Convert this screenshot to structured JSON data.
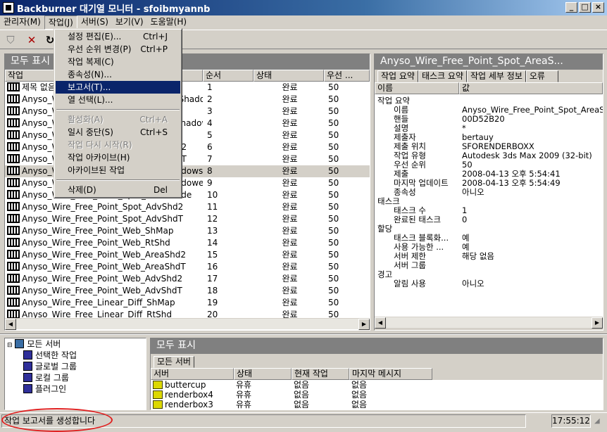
{
  "window": {
    "title": "Backburner 대기열 모니터 - sfoibmyannb",
    "min": "_",
    "max": "□",
    "close": "×"
  },
  "menubar": [
    "관리자(M)",
    "작업(J)",
    "서버(S)",
    "보기(V)",
    "도움말(H)"
  ],
  "dropdown": [
    {
      "label": "설정 편집(E)...",
      "shortcut": "Ctrl+J"
    },
    {
      "label": "우선 순위 변경(P)",
      "shortcut": "Ctrl+P"
    },
    {
      "label": "작업 복제(C)",
      "shortcut": ""
    },
    {
      "label": "종속성(N)...",
      "shortcut": ""
    },
    {
      "label": "보고서(T)...",
      "shortcut": ""
    },
    {
      "label": "열 선택(L)...",
      "shortcut": ""
    },
    {
      "label": "활성화(A)",
      "shortcut": "Ctrl+A"
    },
    {
      "label": "일시 중단(S)",
      "shortcut": "Ctrl+S"
    },
    {
      "label": "작업 다시 시작(R)",
      "shortcut": ""
    },
    {
      "label": "작업 아카이브(H)",
      "shortcut": ""
    },
    {
      "label": "아카이브된 작업",
      "shortcut": ""
    },
    {
      "label": "삭제(D)",
      "shortcut": "Del"
    }
  ],
  "jobs_panel": {
    "title": "모두 표시",
    "columns": [
      "작업",
      "순서",
      "상태",
      "우선 ..."
    ],
    "rows": [
      {
        "name": "제목 없음",
        "order": "1",
        "status": "완료",
        "priority": "50"
      },
      {
        "name": "Anyso_Wire_Free_Point_Spot_ShMap_ShadowWindow",
        "order": "2",
        "status": "완료",
        "priority": "50"
      },
      {
        "name": "Anyso_Wire_Free_Point_Spot_ShMap",
        "order": "3",
        "status": "완료",
        "priority": "50"
      },
      {
        "name": "Anyso_Wire_Free_Point_Spot_RtShd_ShadowWindow",
        "order": "4",
        "status": "완료",
        "priority": "50"
      },
      {
        "name": "Anyso_Wire_Free_Point_Spot_RtShd",
        "order": "5",
        "status": "완료",
        "priority": "50"
      },
      {
        "name": "Anyso_Wire_Free_Point_Spot_AreaShd2",
        "order": "6",
        "status": "완료",
        "priority": "50"
      },
      {
        "name": "Anyso_Wire_Free_Point_Spot_AreaShdT",
        "order": "7",
        "status": "완료",
        "priority": "50"
      },
      {
        "name": "Anyso_Wire_Free_Point_Spot_AreaShadows",
        "order": "8",
        "status": "완료",
        "priority": "50"
      },
      {
        "name": "Anyso_Wire_Free_Point_Spot_AreaShadowe",
        "order": "9",
        "status": "완료",
        "priority": "50"
      },
      {
        "name": "Anyso_Wire_Free_Point_Spot_AreaShade",
        "order": "10",
        "status": "완료",
        "priority": "50"
      },
      {
        "name": "Anyso_Wire_Free_Point_Spot_AdvShd2",
        "order": "11",
        "status": "완료",
        "priority": "50"
      },
      {
        "name": "Anyso_Wire_Free_Point_Spot_AdvShdT",
        "order": "12",
        "status": "완료",
        "priority": "50"
      },
      {
        "name": "Anyso_Wire_Free_Point_Web_ShMap",
        "order": "13",
        "status": "완료",
        "priority": "50"
      },
      {
        "name": "Anyso_Wire_Free_Point_Web_RtShd",
        "order": "14",
        "status": "완료",
        "priority": "50"
      },
      {
        "name": "Anyso_Wire_Free_Point_Web_AreaShd2",
        "order": "15",
        "status": "완료",
        "priority": "50"
      },
      {
        "name": "Anyso_Wire_Free_Point_Web_AreaShdT",
        "order": "16",
        "status": "완료",
        "priority": "50"
      },
      {
        "name": "Anyso_Wire_Free_Point_Web_AdvShd2",
        "order": "17",
        "status": "완료",
        "priority": "50"
      },
      {
        "name": "Anyso_Wire_Free_Point_Web_AdvShdT",
        "order": "18",
        "status": "완료",
        "priority": "50"
      },
      {
        "name": "Anyso_Wire_Free_Linear_Diff_ShMap",
        "order": "19",
        "status": "완료",
        "priority": "50"
      },
      {
        "name": "Anyso_Wire_Free_Linear_Diff_RtShd",
        "order": "20",
        "status": "완료",
        "priority": "50"
      }
    ]
  },
  "details_panel": {
    "title": "Anyso_Wire_Free_Point_Spot_AreaS...",
    "tabs": [
      "작업 요약",
      "태스크 요약",
      "작업 세부 정보",
      "오류"
    ],
    "columns": [
      "이름",
      "값"
    ],
    "rows": [
      {
        "k": "작업 요약",
        "v": "",
        "indent": 0
      },
      {
        "k": "이름",
        "v": "Anyso_Wire_Free_Point_Spot_AreaS",
        "indent": 1
      },
      {
        "k": "핸들",
        "v": "00D52B20",
        "indent": 1
      },
      {
        "k": "설명",
        "v": "*",
        "indent": 1
      },
      {
        "k": "제출자",
        "v": "bertauy",
        "indent": 1
      },
      {
        "k": "제출 위치",
        "v": "SFORENDERBOXX",
        "indent": 1
      },
      {
        "k": "작업 유형",
        "v": "Autodesk 3ds Max 2009 (32-bit)",
        "indent": 1
      },
      {
        "k": "우선 순위",
        "v": "50",
        "indent": 1
      },
      {
        "k": "제출",
        "v": "2008-04-13 오후 5:54:41",
        "indent": 1
      },
      {
        "k": "마지막 업데이트",
        "v": "2008-04-13 오후 5:54:49",
        "indent": 1
      },
      {
        "k": "종속성",
        "v": "아니오",
        "indent": 1
      },
      {
        "k": "태스크",
        "v": "",
        "indent": 0
      },
      {
        "k": "태스크 수",
        "v": "1",
        "indent": 1
      },
      {
        "k": "완료된 태스크",
        "v": "0",
        "indent": 1
      },
      {
        "k": "할당",
        "v": "",
        "indent": 0
      },
      {
        "k": "태스크 블록화...",
        "v": "예",
        "indent": 1
      },
      {
        "k": "사용 가능한 ...",
        "v": "예",
        "indent": 1
      },
      {
        "k": "서버 제한",
        "v": "해당 없음",
        "indent": 1
      },
      {
        "k": "서버 그룹",
        "v": "",
        "indent": 1
      },
      {
        "k": "경고",
        "v": "",
        "indent": 0
      },
      {
        "k": "알림 사용",
        "v": "아니오",
        "indent": 1
      }
    ]
  },
  "tree": {
    "root": "모든 서버",
    "children": [
      "선택한 작업",
      "글로벌 그룹",
      "로컬 그룹",
      "플러그인"
    ]
  },
  "servers_panel": {
    "title": "모두 표시",
    "tab": "모든 서버",
    "columns": [
      "서버",
      "상태",
      "현재 작업",
      "마지막 메시지"
    ],
    "rows": [
      {
        "server": "buttercup",
        "status": "유휴",
        "job": "없음",
        "msg": "없음"
      },
      {
        "server": "renderbox4",
        "status": "유휴",
        "job": "없음",
        "msg": "없음"
      },
      {
        "server": "renderbox3",
        "status": "유휴",
        "job": "없음",
        "msg": "없음"
      }
    ]
  },
  "statusbar": {
    "message": "작업 보고서를 생성합니다",
    "time": "17:55:12"
  }
}
